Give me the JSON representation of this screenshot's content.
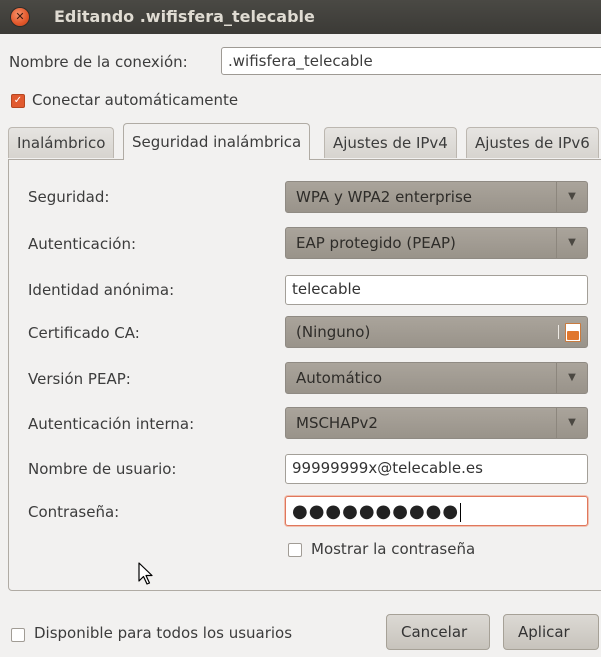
{
  "window": {
    "title": "Editando .wifisfera_telecable"
  },
  "connection": {
    "name_label": "Nombre de la conexión:",
    "name_value": ".wifisfera_telecable",
    "autoconnect_label": "Conectar automáticamente",
    "autoconnect_checked": true
  },
  "tabs": [
    {
      "label": "Inalámbrico"
    },
    {
      "label": "Seguridad inalámbrica",
      "active": true
    },
    {
      "label": "Ajustes de IPv4"
    },
    {
      "label": "Ajustes de IPv6"
    }
  ],
  "security": {
    "security_label": "Seguridad:",
    "security_value": "WPA y WPA2 enterprise",
    "auth_label": "Autenticación:",
    "auth_value": "EAP protegido (PEAP)",
    "anon_label": "Identidad anónima:",
    "anon_value": "telecable",
    "ca_label": "Certificado CA:",
    "ca_value": "(Ninguno)",
    "peap_label": "Versión PEAP:",
    "peap_value": "Automático",
    "inner_label": "Autenticación interna:",
    "inner_value": "MSCHAPv2",
    "user_label": "Nombre de usuario:",
    "user_value": "99999999x@telecable.es",
    "password_label": "Contraseña:",
    "password_mask": "●●●●●●●●●●",
    "show_password_label": "Mostrar la contraseña",
    "show_password_checked": false
  },
  "footer": {
    "all_users_label": "Disponible para todos los usuarios",
    "all_users_checked": false,
    "cancel_label": "Cancelar",
    "apply_label": "Aplicar"
  },
  "icons": {
    "close": "close-icon",
    "dropdown": "chevron-down-icon",
    "file": "file-chooser-icon",
    "checkmark": "checkmark-icon",
    "cursor": "mouse-pointer-icon"
  },
  "colors": {
    "accent": "#e15a2f",
    "titlebar": "#3b3a36",
    "combo": "#a39d94"
  }
}
